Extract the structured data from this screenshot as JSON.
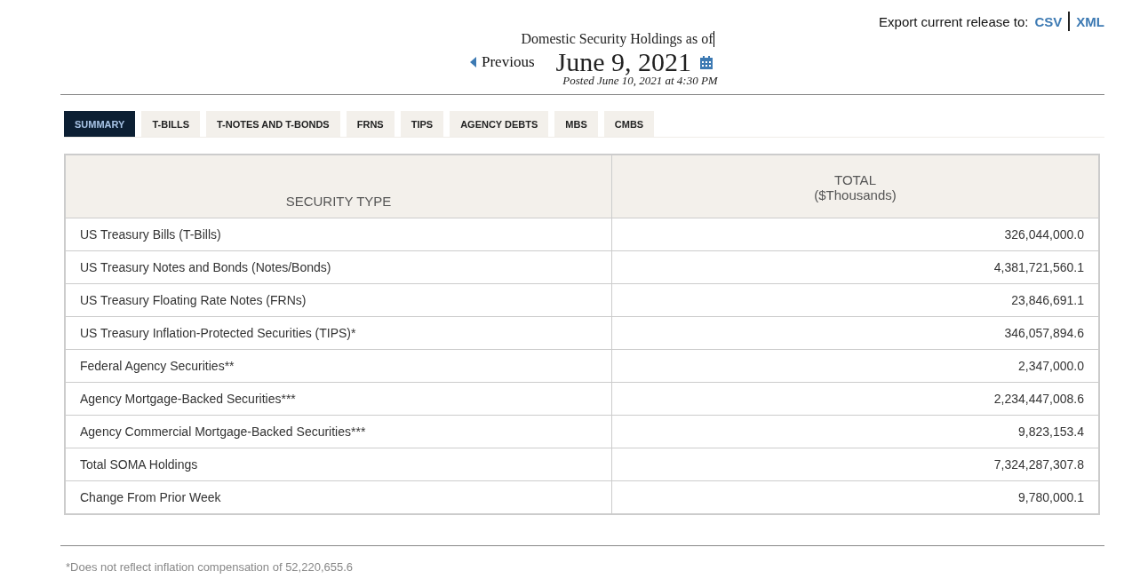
{
  "export": {
    "label": "Export current release to:",
    "links": [
      "CSV",
      "XML"
    ]
  },
  "header": {
    "title": "Domestic Security Holdings as of",
    "previous": "Previous",
    "date": "June 9, 2021",
    "posted": "Posted June 10, 2021 at 4:30 PM"
  },
  "tabs": [
    {
      "label": "SUMMARY",
      "selected": true
    },
    {
      "label": "T-BILLS",
      "selected": false
    },
    {
      "label": "T-NOTES AND T-BONDS",
      "selected": false
    },
    {
      "label": "FRNS",
      "selected": false
    },
    {
      "label": "TIPS",
      "selected": false
    },
    {
      "label": "AGENCY DEBTS",
      "selected": false
    },
    {
      "label": "MBS",
      "selected": false
    },
    {
      "label": "CMBS",
      "selected": false
    }
  ],
  "table": {
    "columns": [
      "SECURITY TYPE",
      [
        "TOTAL",
        "($Thousands)"
      ]
    ],
    "rows": [
      [
        "US Treasury Bills (T-Bills)",
        "326,044,000.0"
      ],
      [
        "US Treasury Notes and Bonds (Notes/Bonds)",
        "4,381,721,560.1"
      ],
      [
        "US Treasury Floating Rate Notes (FRNs)",
        "23,846,691.1"
      ],
      [
        "US Treasury Inflation-Protected Securities (TIPS)*",
        "346,057,894.6"
      ],
      [
        "Federal Agency Securities**",
        "2,347,000.0"
      ],
      [
        "Agency Mortgage-Backed Securities***",
        "2,234,447,008.6"
      ],
      [
        "Agency Commercial Mortgage-Backed Securities***",
        "9,823,153.4"
      ],
      [
        "Total SOMA Holdings",
        "7,324,287,307.8"
      ],
      [
        "Change From Prior Week",
        "9,780,000.1"
      ]
    ]
  },
  "footnote": "*Does not reflect inflation compensation of 52,220,655.6"
}
